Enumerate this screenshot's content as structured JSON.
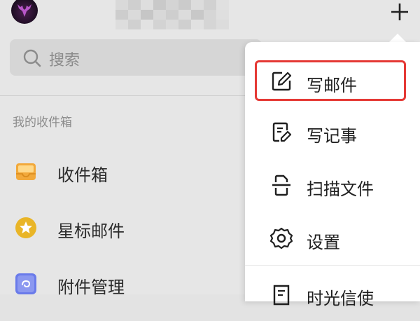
{
  "header": {
    "plus_icon": "plus-icon"
  },
  "search": {
    "placeholder": "搜索"
  },
  "mailboxes": {
    "section_label": "我的收件箱",
    "items": [
      {
        "label": "收件箱",
        "icon": "inbox-icon",
        "color": "#F2A93B"
      },
      {
        "label": "星标邮件",
        "icon": "star-icon",
        "color": "#E9B527"
      },
      {
        "label": "附件管理",
        "icon": "attachment-icon",
        "color": "#6A7BEA"
      }
    ]
  },
  "menu": {
    "items": [
      {
        "label": "写邮件",
        "icon": "compose-icon"
      },
      {
        "label": "写记事",
        "icon": "note-icon"
      },
      {
        "label": "扫描文件",
        "icon": "scan-icon"
      },
      {
        "label": "设置",
        "icon": "settings-icon"
      },
      {
        "label": "时光信使",
        "icon": "time-letter-icon"
      }
    ],
    "highlight_color": "#E53935"
  }
}
